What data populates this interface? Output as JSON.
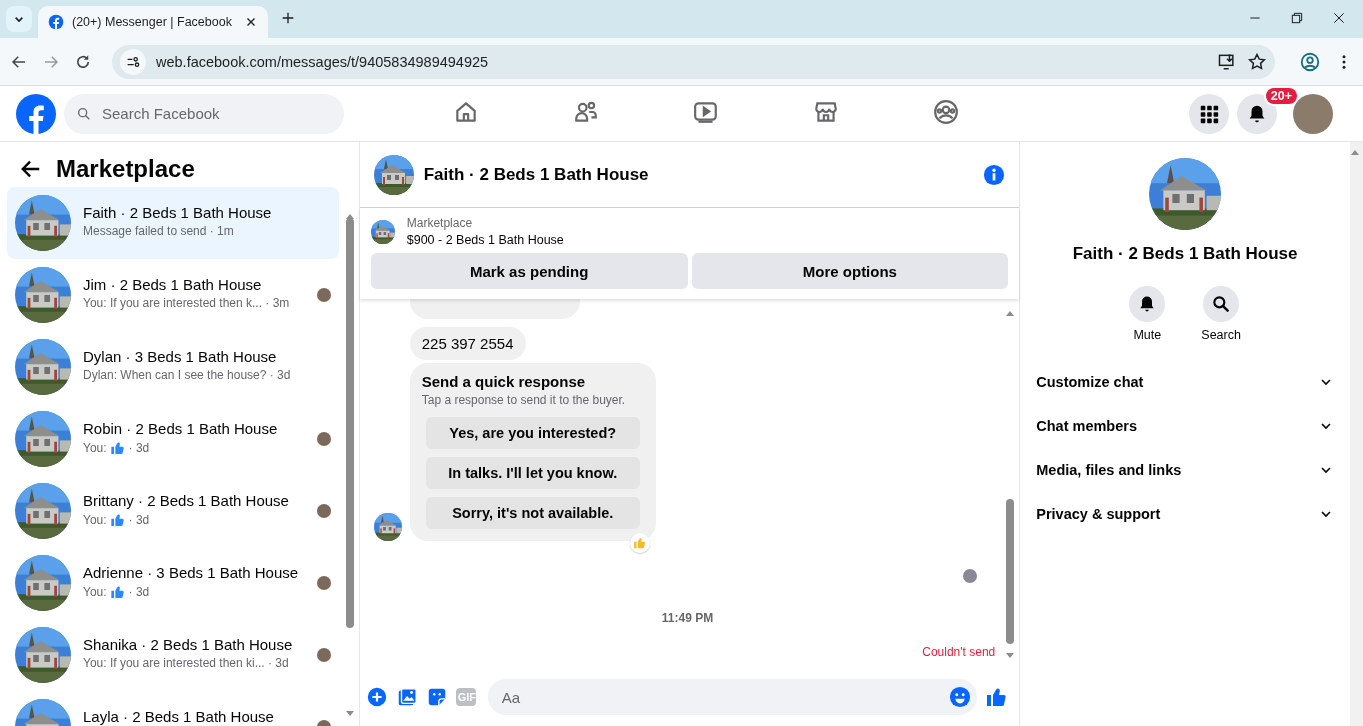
{
  "browser": {
    "tab_title": "(20+) Messenger | Facebook",
    "url": "web.facebook.com/messages/t/9405834989494925"
  },
  "header": {
    "search": {
      "placeholder": "Search Facebook"
    },
    "nav": [
      {
        "kind": "home",
        "selected": false
      },
      {
        "kind": "friends",
        "selected": false
      },
      {
        "kind": "video",
        "selected": false
      },
      {
        "kind": "marketplace",
        "selected": false
      },
      {
        "kind": "groups",
        "selected": false
      }
    ],
    "notification_badge": "20+"
  },
  "sidebar": {
    "title": "Marketplace",
    "conversations": [
      {
        "name": "Faith · 2 Beds 1 Bath House",
        "kind": "text",
        "preview": "Message failed to send · 1m",
        "seen": false,
        "selected": true
      },
      {
        "name": "Jim · 2 Beds 1 Bath House",
        "kind": "text",
        "preview": "You: If you are interested then k... · 3m",
        "seen": true,
        "selected": false
      },
      {
        "name": "Dylan · 3 Beds 1 Bath House",
        "kind": "text",
        "preview": "Dylan: When can I see the house? · 3d",
        "seen": false,
        "selected": false
      },
      {
        "name": "Robin · 2 Beds 1 Bath House",
        "kind": "like",
        "prefix": "You:",
        "suffix": "· 3d",
        "seen": true,
        "selected": false
      },
      {
        "name": "Brittany · 2 Beds 1 Bath House",
        "kind": "like",
        "prefix": "You:",
        "suffix": "· 3d",
        "seen": true,
        "selected": false
      },
      {
        "name": "Adrienne · 3 Beds 1 Bath House",
        "kind": "like",
        "prefix": "You:",
        "suffix": "· 3d",
        "seen": true,
        "selected": false
      },
      {
        "name": "Shanika · 2 Beds 1 Bath House",
        "kind": "text",
        "preview": "You: If you are interested then ki... · 3d",
        "seen": true,
        "selected": false
      },
      {
        "name": "Layla · 2 Beds 1 Bath House",
        "kind": "text",
        "seen": true,
        "selected": false
      }
    ]
  },
  "chat": {
    "title": "Faith · 2 Beds 1 Bath House",
    "listing": {
      "label": "Marketplace",
      "title": "$900 - 2 Beds 1 Bath House"
    },
    "actions": [
      "Mark as pending",
      "More options"
    ],
    "messages": [
      {
        "kind": "cut"
      },
      {
        "kind": "text",
        "text": "225 397 2554"
      },
      {
        "kind": "quick_responses",
        "title": "Send a quick response",
        "subtitle": "Tap a response to send it to the buyer.",
        "options": [
          "Yes, are you interested?",
          "In talks. I'll let you know.",
          "Sorry, it's not available."
        ]
      }
    ],
    "timestamp": "11:49 PM",
    "status": "Couldn't send",
    "composer": {
      "placeholder": "Aa",
      "gif_label": "GIF"
    }
  },
  "details": {
    "name": "Faith · 2 Beds 1 Bath House",
    "actions": [
      {
        "kind": "mute",
        "label": "Mute"
      },
      {
        "kind": "search",
        "label": "Search"
      }
    ],
    "sections": [
      {
        "label": "Customize chat",
        "expanded": false
      },
      {
        "label": "Chat members",
        "expanded": false
      },
      {
        "label": "Media, files and links",
        "expanded": false
      },
      {
        "label": "Privacy & support",
        "expanded": false
      }
    ]
  }
}
